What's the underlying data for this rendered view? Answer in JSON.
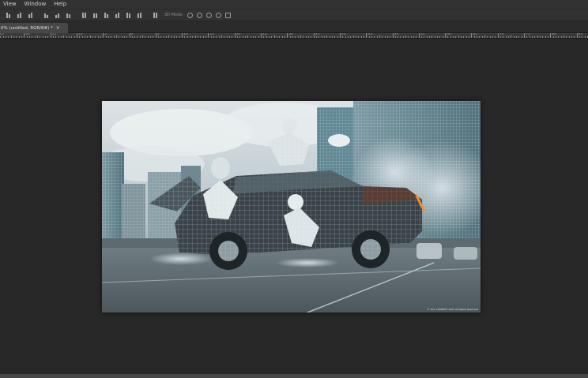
{
  "menu": {
    "items": [
      {
        "id": "view",
        "label": "View"
      },
      {
        "id": "window",
        "label": "Window"
      },
      {
        "id": "help",
        "label": "Help"
      }
    ]
  },
  "options_bar": {
    "three_d_mode_label": "3D Mode:"
  },
  "document": {
    "tab_title": "0% (untitled, RGB/8#) *",
    "close_symbol": "×"
  },
  "ruler": {
    "labels": [
      "25",
      "20",
      "15",
      "10",
      "5",
      "0",
      "5",
      "10",
      "15",
      "20",
      "25",
      "30",
      "35",
      "40",
      "45",
      "50",
      "55",
      "60",
      "65",
      "70",
      "75",
      "80",
      "85"
    ]
  },
  "canvas": {
    "description_icon": "wireframe-render-image",
    "watermark": "© Your COMPANY 2023 All Rights Reserved"
  },
  "colors": {
    "app_background": "#282828",
    "toolbar": "#323232",
    "active_tab": "#474747"
  }
}
